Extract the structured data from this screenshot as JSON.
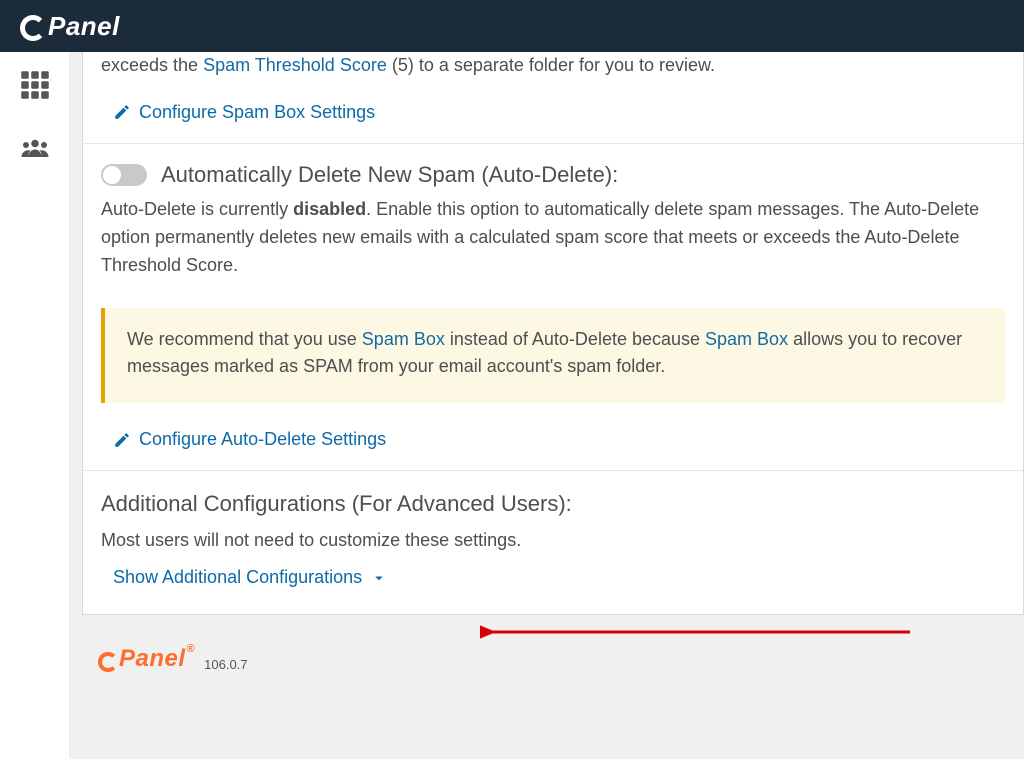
{
  "brand": "Panel",
  "spambox": {
    "partial_pre": "exceeds the ",
    "link": "Spam Threshold Score",
    "partial_post": " (5) to a separate folder for you to review.",
    "configure": "Configure Spam Box Settings"
  },
  "autodelete": {
    "heading": "Automatically Delete New Spam (Auto-Delete):",
    "status_pre": "Auto-Delete is currently ",
    "status_strong": "disabled",
    "status_post": ". Enable this option to automatically delete spam messages. The Auto-Delete option permanently deletes new emails with a calculated spam score that meets or exceeds the Auto-Delete Threshold Score.",
    "callout_pre": "We recommend that you use ",
    "callout_link1": "Spam Box",
    "callout_mid": " instead of Auto-Delete because ",
    "callout_link2": "Spam Box",
    "callout_post": " allows you to recover messages marked as SPAM from your email account's spam folder.",
    "configure": "Configure Auto-Delete Settings"
  },
  "additional": {
    "heading": "Additional Configurations (For Advanced Users):",
    "subtext": "Most users will not need to customize these settings.",
    "show": "Show Additional Configurations"
  },
  "footer": {
    "brand": "Panel",
    "version": "106.0.7"
  }
}
